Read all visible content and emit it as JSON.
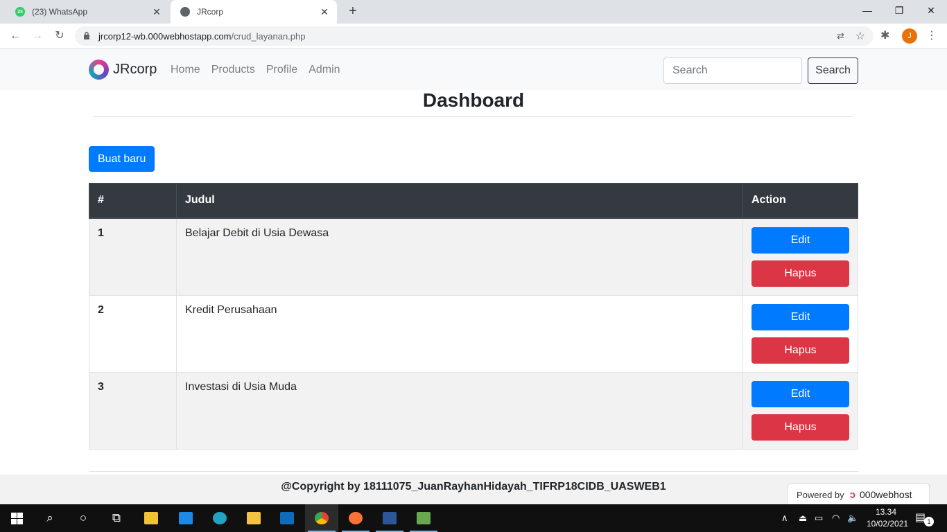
{
  "browser": {
    "tabs": [
      {
        "title": "(23) WhatsApp",
        "badge": "23",
        "active": false
      },
      {
        "title": "JRcorp",
        "active": true
      }
    ],
    "url_host": "jrcorp12-wb.000webhostapp.com",
    "url_path": "/crud_layanan.php",
    "profile_initial": "J"
  },
  "navbar": {
    "brand": "JRcorp",
    "links": [
      "Home",
      "Products",
      "Profile",
      "Admin"
    ],
    "search_placeholder": "Search",
    "search_button": "Search"
  },
  "main": {
    "title": "Dashboard",
    "new_button": "Buat baru",
    "table": {
      "headers": [
        "#",
        "Judul",
        "Action"
      ],
      "rows": [
        {
          "no": "1",
          "judul": "Belajar Debit di Usia Dewasa"
        },
        {
          "no": "2",
          "judul": "Kredit Perusahaan"
        },
        {
          "no": "3",
          "judul": "Investasi di Usia Muda"
        }
      ],
      "edit_label": "Edit",
      "delete_label": "Hapus"
    }
  },
  "footer": {
    "copyright": "@Copyright by 18111075_JuanRayhanHidayah_TIFRP18CIDB_UASWEB1",
    "powered_by": "Powered by",
    "host_name": "000webhost"
  },
  "taskbar": {
    "time": "13.34",
    "date": "10/02/2021",
    "notification_count": "1"
  },
  "colors": {
    "primary": "#007bff",
    "danger": "#dc3545",
    "dark": "#343a40",
    "navbar_bg": "#f8f9fa"
  }
}
